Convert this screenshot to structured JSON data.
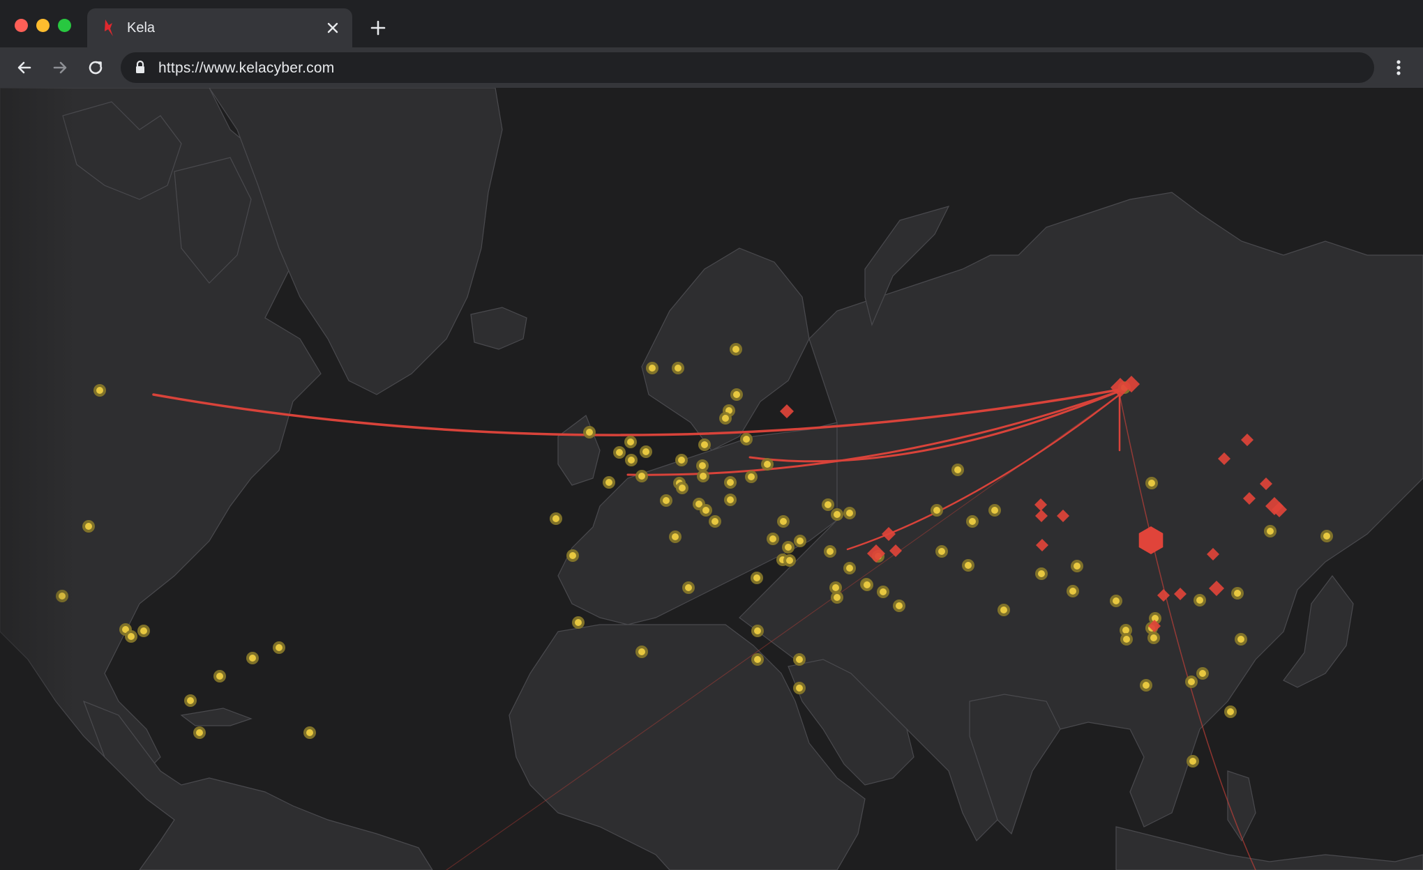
{
  "browser": {
    "tab": {
      "title": "Kela",
      "favicon": "kela-logo-icon",
      "close_icon": "close-icon"
    },
    "new_tab_icon": "plus-icon",
    "toolbar": {
      "back_icon": "arrow-left-icon",
      "forward_icon": "arrow-right-icon",
      "reload_icon": "reload-icon",
      "lock_icon": "lock-icon",
      "url": "https://www.kelacyber.com",
      "menu_icon": "more-vertical-icon"
    },
    "colors": {
      "tabstrip": "#202124",
      "toolbar": "#35363a",
      "omnibox": "#202124",
      "brand_red": "#e0282e"
    }
  },
  "map": {
    "theme": {
      "ocean": "#1e1e1f",
      "land": "#2e2e30",
      "border": "#4a4a4e",
      "point_fill": "#e8c840",
      "point_glow": "#8a7a2a",
      "threat_color": "#e0443a",
      "arc_color": "#d9433a"
    },
    "marker_types": [
      "yellow-point-marker",
      "red-diamond-threat-marker",
      "red-hexagon-threat-marker",
      "attack-arc-line"
    ]
  }
}
